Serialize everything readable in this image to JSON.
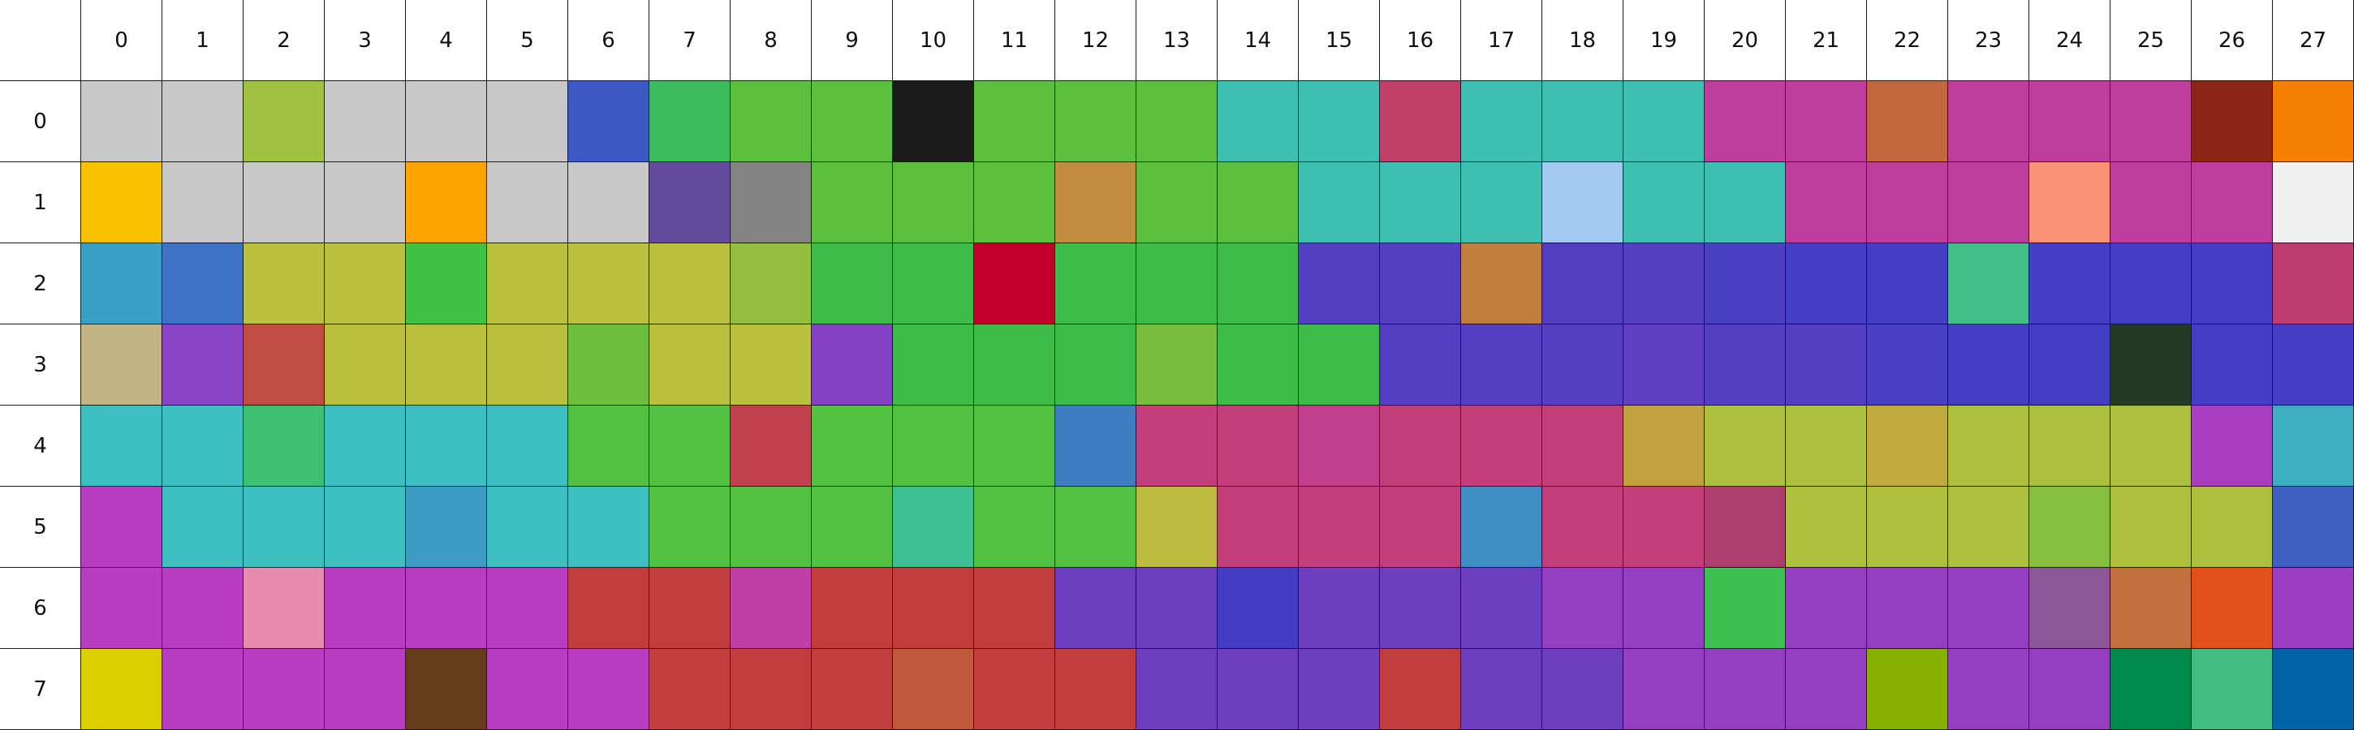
{
  "columns": [
    "0",
    "1",
    "2",
    "3",
    "4",
    "5",
    "6",
    "7",
    "8",
    "9",
    "10",
    "11",
    "12",
    "13",
    "14",
    "15",
    "16",
    "17",
    "18",
    "19",
    "20",
    "21",
    "22",
    "23",
    "24",
    "25",
    "26",
    "27"
  ],
  "rows": [
    "0",
    "1",
    "2",
    "3",
    "4",
    "5",
    "6",
    "7"
  ],
  "cells": [
    [
      "#c8c8c8",
      "#c8c8c8",
      "#a1c141",
      "#c8c8c8",
      "#c8c8c8",
      "#c8c8c8",
      "#3e58c6",
      "#3dbc5e",
      "#5dbf3e",
      "#5dbf3e",
      "#1a1a1a",
      "#5dbf3e",
      "#5dbf3e",
      "#5dbf3e",
      "#3ebfb2",
      "#3ebfb2",
      "#c14069",
      "#3ebfb2",
      "#3ebfb2",
      "#3ebfb2",
      "#bf3e9d",
      "#bf3e9d",
      "#c1683e",
      "#bf3e9d",
      "#bf3e9d",
      "#bf3e9d",
      "#8b2617",
      "#f77f00"
    ],
    [
      "#f8c200",
      "#c8c8c8",
      "#c8c8c8",
      "#c8c8c8",
      "#ffa300",
      "#c8c8c8",
      "#c8c8c8",
      "#644b9b",
      "#848484",
      "#5dbf3e",
      "#5dbf3e",
      "#5dbf3e",
      "#c28d41",
      "#5dbf3e",
      "#5dbf3e",
      "#3ebfb2",
      "#3ebfb2",
      "#3ebfb2",
      "#a3c9f0",
      "#3ebfb2",
      "#3ebfb2",
      "#bf3e9d",
      "#bf3e9d",
      "#bf3e9d",
      "#f99274",
      "#bf3e9d",
      "#bf3e9d",
      "#f0f0f0"
    ],
    [
      "#3ba1c4",
      "#3e72c4",
      "#bac141",
      "#bac141",
      "#41c141",
      "#bac141",
      "#bac141",
      "#bac141",
      "#94be3e",
      "#3dbc49",
      "#3dbc49",
      "#c1002c",
      "#3dbc49",
      "#3dbc49",
      "#3dbc49",
      "#543ec1",
      "#543ec1",
      "#c07f3e",
      "#543ec1",
      "#543ec1",
      "#4a3ec1",
      "#433ec4",
      "#433ec4",
      "#41be89",
      "#433ec4",
      "#433ec4",
      "#433ec4",
      "#be3e72"
    ],
    [
      "#c4b383",
      "#8a44c4",
      "#c14c41",
      "#bac141",
      "#bac141",
      "#bac141",
      "#6ebe3e",
      "#bac141",
      "#bac141",
      "#8441c4",
      "#3dbc49",
      "#3dbc49",
      "#3dbc49",
      "#77be3e",
      "#3dbc49",
      "#3dbc49",
      "#543ec1",
      "#543ec1",
      "#543ec1",
      "#5f3ec1",
      "#543ec1",
      "#543ec1",
      "#4a3ec1",
      "#433ec4",
      "#433ec4",
      "#263b23",
      "#433ec4",
      "#433ec4"
    ],
    [
      "#3ebfc2",
      "#3ebfc2",
      "#3dbf74",
      "#3ebfc2",
      "#3ebfc2",
      "#3ebfc2",
      "#52c141",
      "#52c141",
      "#c1414f",
      "#52c141",
      "#52c141",
      "#52c141",
      "#3e7dc1",
      "#c13e7a",
      "#c13e7a",
      "#c13e8a",
      "#c13e7a",
      "#c13e7a",
      "#c13e7a",
      "#c1a13e",
      "#adbf3e",
      "#adbf3e",
      "#c1ab3e",
      "#adbf3e",
      "#adbf3e",
      "#adbf3e",
      "#aa3ec1",
      "#3eafc1"
    ],
    [
      "#b83ec1",
      "#3ebfc2",
      "#3ebfc2",
      "#3ebfc2",
      "#3e9bc4",
      "#3ebfc2",
      "#3ebfc2",
      "#52c141",
      "#52c141",
      "#52c141",
      "#3ebf94",
      "#52c141",
      "#52c141",
      "#bdbb41",
      "#c13e7a",
      "#c13e7a",
      "#c13e7a",
      "#3e8dc4",
      "#c13e7a",
      "#c13e7a",
      "#ad3e70",
      "#adbf3e",
      "#adbf3e",
      "#adbf3e",
      "#86be3e",
      "#adbf3e",
      "#adbf3e",
      "#3e5fc1"
    ],
    [
      "#b83ec1",
      "#b83ec1",
      "#e88aae",
      "#b83ec1",
      "#b83ec1",
      "#b83ec1",
      "#c13e3e",
      "#c13e3e",
      "#c13ea6",
      "#c13e3e",
      "#c13e3e",
      "#c13e3e",
      "#6e3ec1",
      "#6e3ec1",
      "#433ec1",
      "#6e3ec1",
      "#6e3ec1",
      "#6e3ec1",
      "#943ec1",
      "#943ec1",
      "#3ebf52",
      "#943ec1",
      "#943ec1",
      "#943ec1",
      "#8b5797",
      "#c1703e",
      "#e2511d",
      "#9c3ec1"
    ],
    [
      "#dccf00",
      "#b83ec1",
      "#b83ec1",
      "#b83ec1",
      "#643d1b",
      "#b83ec1",
      "#b83ec1",
      "#c13e3e",
      "#c13e3e",
      "#c13e3e",
      "#c1583e",
      "#c13e3e",
      "#c13e3e",
      "#6e3ec1",
      "#6e3ec1",
      "#6e3ec1",
      "#c13e3e",
      "#6e3ec1",
      "#6e3ec1",
      "#943ec1",
      "#943ec1",
      "#943ec1",
      "#87b000",
      "#943ec1",
      "#943ec1",
      "#00894b",
      "#41be80",
      "#0063a8"
    ]
  ]
}
